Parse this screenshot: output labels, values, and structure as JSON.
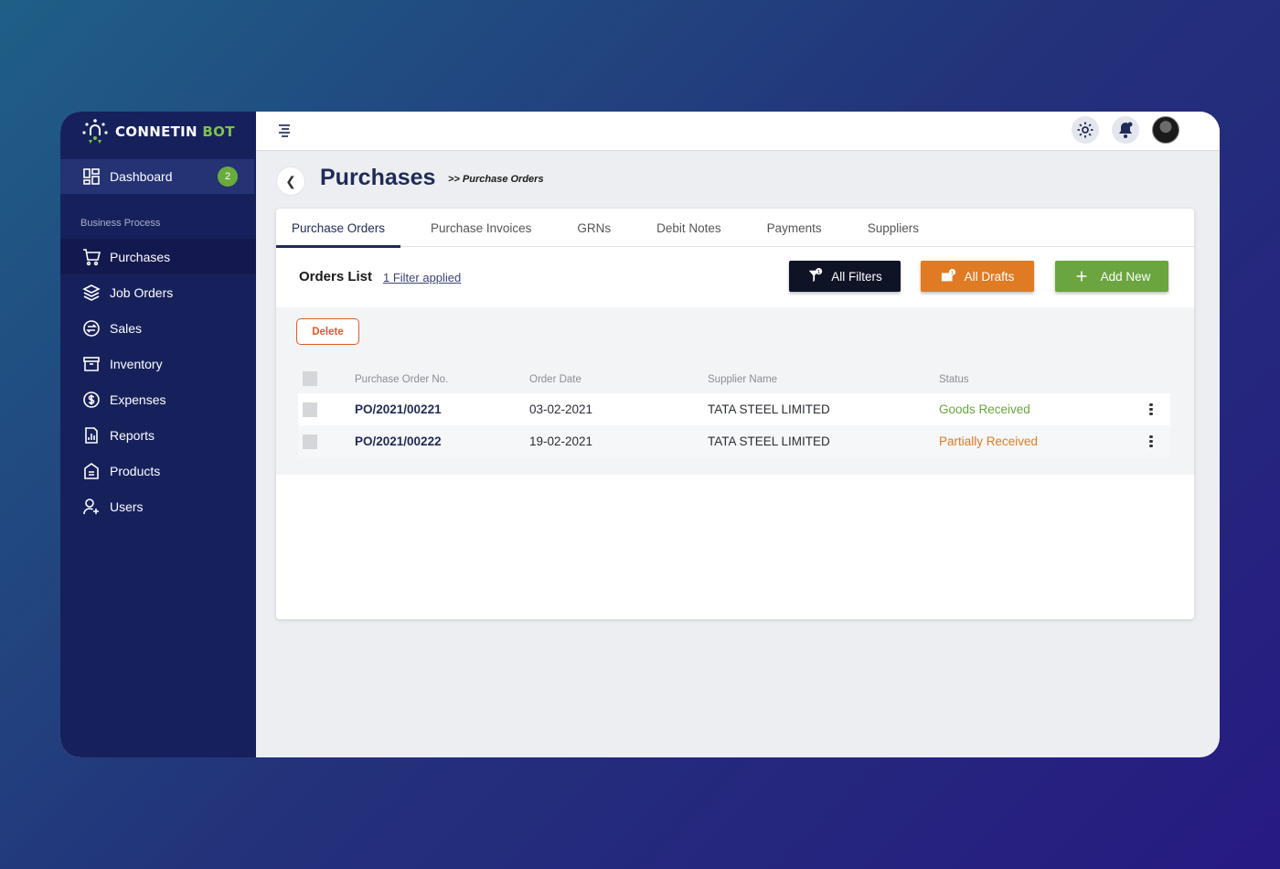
{
  "brand": {
    "name_part1": "CONNETIN",
    "name_part2": "BOT",
    "accent": "#7ec24a"
  },
  "sidebar": {
    "dashboard": {
      "label": "Dashboard",
      "badge": "2"
    },
    "section_label": "Business Process",
    "items": [
      {
        "label": "Purchases",
        "icon": "cart-icon",
        "active": true
      },
      {
        "label": "Job Orders",
        "icon": "layers-icon"
      },
      {
        "label": "Sales",
        "icon": "exchange-icon"
      },
      {
        "label": "Inventory",
        "icon": "archive-icon"
      },
      {
        "label": "Expenses",
        "icon": "money-icon"
      },
      {
        "label": "Reports",
        "icon": "chart-icon"
      },
      {
        "label": "Products",
        "icon": "product-icon"
      },
      {
        "label": "Users",
        "icon": "user-add-icon"
      }
    ]
  },
  "header": {
    "title": "Purchases",
    "breadcrumb": ">> Purchase Orders"
  },
  "tabs": [
    {
      "label": "Purchase Orders",
      "active": true
    },
    {
      "label": "Purchase Invoices"
    },
    {
      "label": "GRNs"
    },
    {
      "label": "Debit Notes"
    },
    {
      "label": "Payments"
    },
    {
      "label": "Suppliers"
    }
  ],
  "toolbar": {
    "title": "Orders List",
    "filter_link": "1 Filter applied",
    "filters_btn": "All Filters",
    "filters_count": "1",
    "drafts_btn": "All Drafts",
    "drafts_count": "1",
    "add_btn": "Add New"
  },
  "delete_label": "Delete",
  "table": {
    "columns": [
      "Purchase Order No.",
      "Order Date",
      "Supplier Name",
      "Status"
    ],
    "rows": [
      {
        "po": "PO/2021/00221",
        "date": "03-02-2021",
        "supplier": "TATA STEEL LIMITED",
        "status": "Goods Received",
        "status_color": "#6aa53f"
      },
      {
        "po": "PO/2021/00222",
        "date": "19-02-2021",
        "supplier": "TATA STEEL LIMITED",
        "status": "Partially Received",
        "status_color": "#e07b24"
      }
    ]
  }
}
